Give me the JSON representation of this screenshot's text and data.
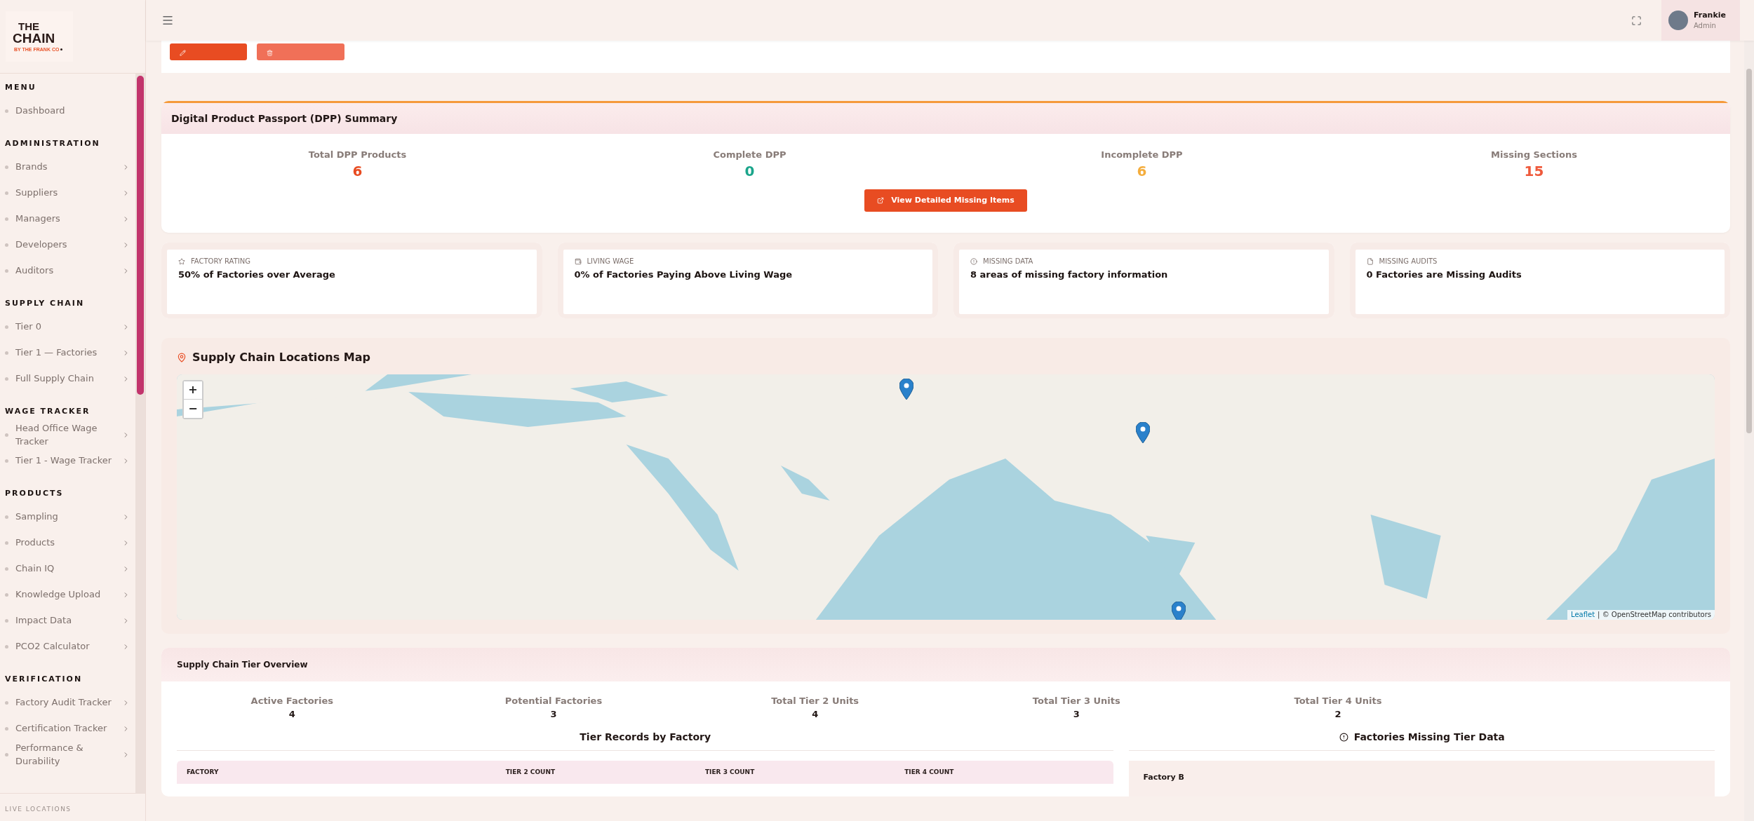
{
  "sidebar": {
    "logo": {
      "line1": "THE",
      "line2": "CHAIN",
      "tagline": "BY THE FRANK CO"
    },
    "sections": [
      {
        "title": "MENU",
        "items": [
          {
            "label": "Dashboard",
            "has_submenu": false
          }
        ]
      },
      {
        "title": "ADMINISTRATION",
        "items": [
          {
            "label": "Brands",
            "has_submenu": true
          },
          {
            "label": "Suppliers",
            "has_submenu": true
          },
          {
            "label": "Managers",
            "has_submenu": true
          },
          {
            "label": "Developers",
            "has_submenu": true
          },
          {
            "label": "Auditors",
            "has_submenu": true
          }
        ]
      },
      {
        "title": "SUPPLY CHAIN",
        "items": [
          {
            "label": "Tier 0",
            "has_submenu": true
          },
          {
            "label": "Tier 1 — Factories",
            "has_submenu": true
          },
          {
            "label": "Full Supply Chain",
            "has_submenu": true
          }
        ]
      },
      {
        "title": "WAGE TRACKER",
        "items": [
          {
            "label": "Head Office Wage Tracker",
            "has_submenu": true
          },
          {
            "label": "Tier 1 - Wage Tracker",
            "has_submenu": true
          }
        ]
      },
      {
        "title": "PRODUCTS",
        "items": [
          {
            "label": "Sampling",
            "has_submenu": true
          },
          {
            "label": "Products",
            "has_submenu": true
          },
          {
            "label": "Chain IQ",
            "has_submenu": true
          },
          {
            "label": "Knowledge Upload",
            "has_submenu": true
          },
          {
            "label": "Impact Data",
            "has_submenu": true
          },
          {
            "label": "PCO2 Calculator",
            "has_submenu": true
          }
        ]
      },
      {
        "title": "VERIFICATION",
        "items": [
          {
            "label": "Factory Audit Tracker",
            "has_submenu": true
          },
          {
            "label": "Certification Tracker",
            "has_submenu": true
          },
          {
            "label": "Performance & Durability",
            "has_submenu": true
          }
        ]
      }
    ],
    "footer_label": "LIVE LOCATIONS"
  },
  "header": {
    "user": {
      "name": "Frankie",
      "role": "Admin"
    }
  },
  "dpp_summary": {
    "title": "Digital Product Passport (DPP) Summary",
    "stats": [
      {
        "label": "Total DPP Products",
        "value": "6",
        "color": "#e84c22"
      },
      {
        "label": "Complete DPP",
        "value": "0",
        "color": "#1ba58b"
      },
      {
        "label": "Incomplete DPP",
        "value": "6",
        "color": "#f4ad3d"
      },
      {
        "label": "Missing Sections",
        "value": "15",
        "color": "#ef5a3c"
      }
    ],
    "button": "View Detailed Missing Items"
  },
  "metric_cards": [
    {
      "kind": "star",
      "label": "FACTORY RATING",
      "text": "50% of Factories over Average"
    },
    {
      "kind": "wallet",
      "label": "LIVING WAGE",
      "text": "0% of Factories Paying Above Living Wage"
    },
    {
      "kind": "alert",
      "label": "MISSING DATA",
      "text": "8 areas of missing factory information"
    },
    {
      "kind": "file",
      "label": "MISSING AUDITS",
      "text": "0 Factories are Missing Audits"
    }
  ],
  "map": {
    "title": "Supply Chain Locations Map",
    "zoom_in": "+",
    "zoom_out": "−",
    "attribution_link": "Leaflet",
    "attribution": "| © OpenStreetMap contributors"
  },
  "tier_overview": {
    "title": "Supply Chain Tier Overview",
    "stats": [
      {
        "label": "Active Factories",
        "value": "4"
      },
      {
        "label": "Potential Factories",
        "value": "3"
      },
      {
        "label": "Total Tier 2 Units",
        "value": "4"
      },
      {
        "label": "Total Tier 3 Units",
        "value": "3"
      },
      {
        "label": "Total Tier 4 Units",
        "value": "2"
      }
    ],
    "records": {
      "title": "Tier Records by Factory",
      "columns": [
        "FACTORY",
        "TIER 2 COUNT",
        "TIER 3 COUNT",
        "TIER 4 COUNT"
      ]
    },
    "missing": {
      "title": "Factories Missing Tier Data",
      "rows": [
        {
          "name": "Factory B"
        }
      ]
    }
  }
}
